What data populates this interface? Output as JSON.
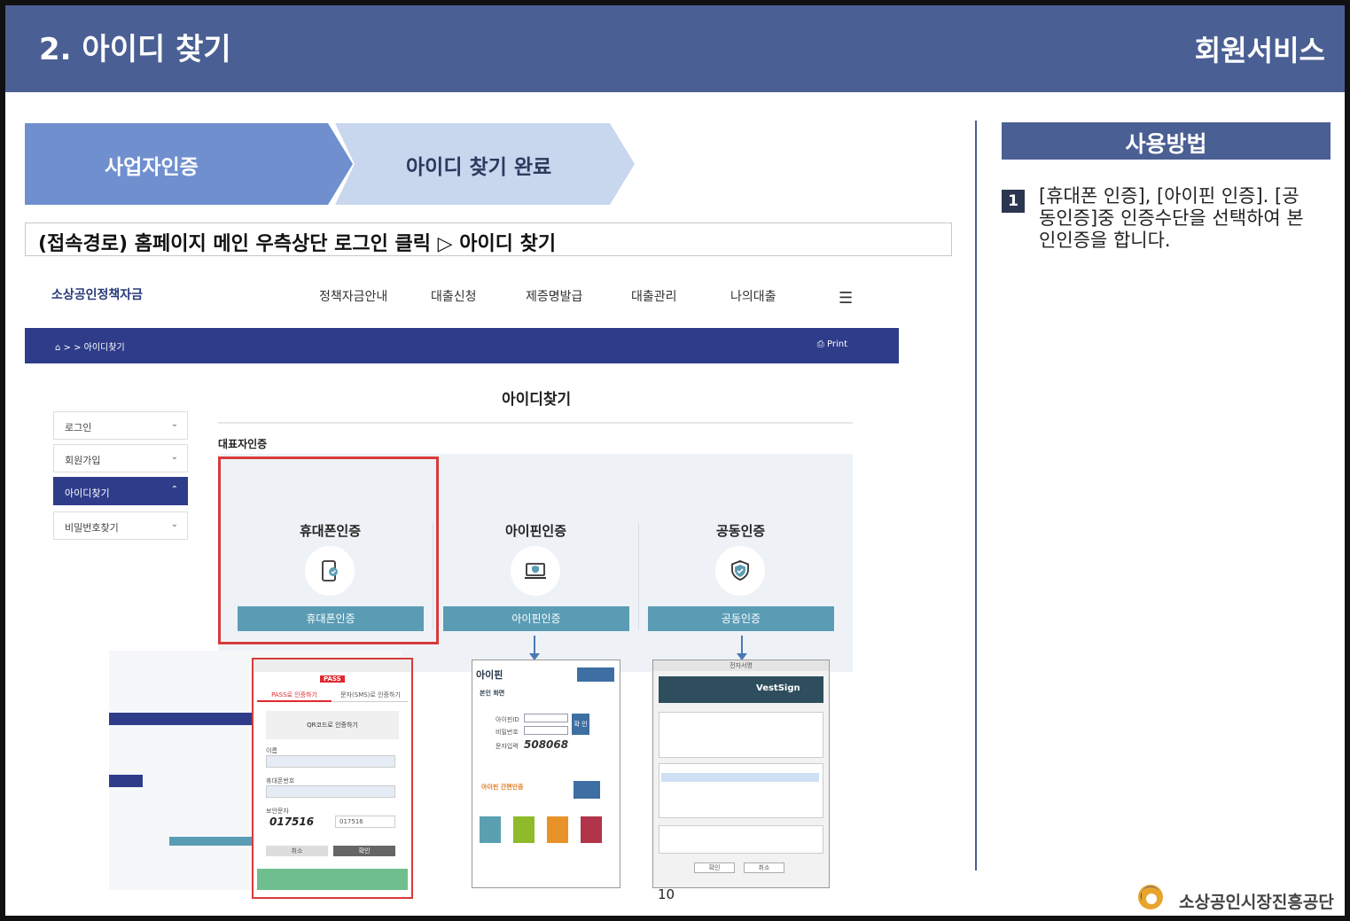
{
  "header": {
    "title": "2. 아이디 찾기",
    "section": "회원서비스"
  },
  "steps": [
    "사업자인증",
    "아이디 찾기 완료"
  ],
  "access_path": "(접속경로) 홈페이지 메인 우측상단 로그인 클릭 ▷ 아이디 찾기",
  "site": {
    "logo": "소상공인정책자금",
    "nav": [
      "정책자금안내",
      "대출신청",
      "제증명발급",
      "대출관리",
      "나의대출"
    ],
    "breadcrumb": "> > 아이디찾기",
    "print": "Print",
    "page_title": "아이디찾기",
    "side_menu": [
      {
        "label": "로그인",
        "active": false
      },
      {
        "label": "회원가입",
        "active": false
      },
      {
        "label": "아이디찾기",
        "active": true
      },
      {
        "label": "비밀번호찾기",
        "active": false
      }
    ],
    "rep_label": "대표자인증",
    "cards": [
      {
        "title": "휴대폰인증",
        "button": "휴대폰인증",
        "icon": "phone-certify-icon"
      },
      {
        "title": "아이핀인증",
        "button": "아이핀인증",
        "icon": "laptop-shield-icon"
      },
      {
        "title": "공동인증",
        "button": "공동인증",
        "icon": "shield-check-icon"
      }
    ]
  },
  "popups": {
    "phone": {
      "tab1": "PASS로 인증하기",
      "tab2": "문자(SMS)로 인증하기",
      "qr": "QR코드로 인증하기",
      "name": "이름",
      "phone": "휴대폰번호",
      "captcha_label": "보안문자",
      "captcha": "017516",
      "cancel": "취소",
      "confirm": "확인",
      "brand": "PASS"
    },
    "ipin": {
      "brand": "아이핀",
      "section": "본인 화면",
      "id": "아이핀ID",
      "pw": "비밀번호",
      "captcha_label": "문자입력",
      "captcha": "508068",
      "confirm": "확 인",
      "simple": "아이핀 간편인증"
    },
    "cert": {
      "title": "전자서명",
      "brand": "VestSign",
      "confirm": "확인",
      "cancel": "취소"
    }
  },
  "usage": {
    "header": "사용방법",
    "steps": [
      {
        "num": "1",
        "text": "[휴대폰 인증], [아이핀 인증]. [공동인증]중 인증수단을 선택하여 본인인증을 합니다."
      }
    ]
  },
  "footer": {
    "page": "10",
    "org": "소상공인시장진흥공단"
  },
  "colors": {
    "header": "#4a5f93",
    "step_active": "#6f8fcf",
    "step_next": "#c8d6ee",
    "site_bar": "#2e3c8a",
    "card_button": "#5b9cb5",
    "highlight": "#d83b3b"
  }
}
